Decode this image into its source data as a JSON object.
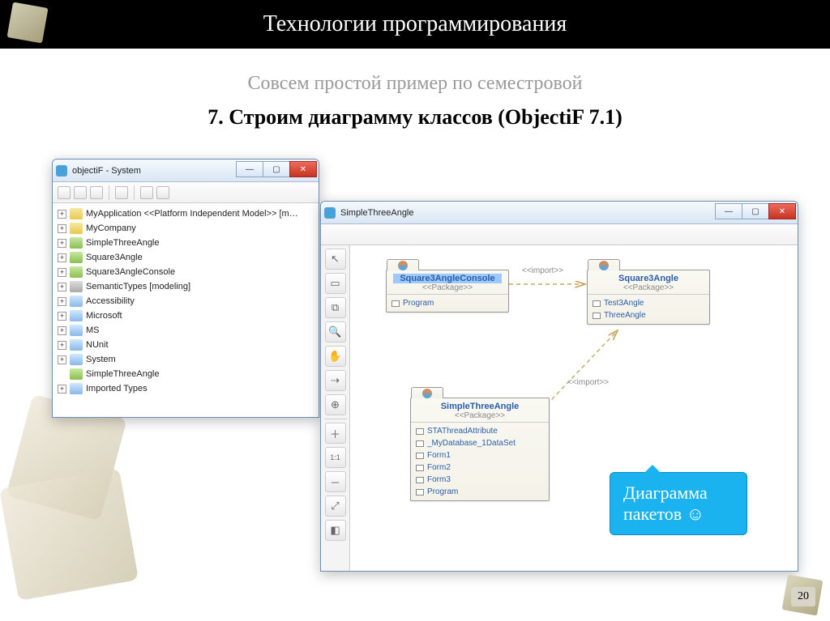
{
  "slide": {
    "header": "Технологии программирования",
    "subtitle_grey": "Совсем простой пример по семестровой",
    "subtitle_bold": "7. Строим диаграмму классов (ObjectiF 7.1)",
    "page_number": "20"
  },
  "tree_window": {
    "title": "objectiF - System",
    "items": [
      {
        "expand": "+",
        "icon": "folder",
        "label": "MyApplication <<Platform Independent Model>> [m…"
      },
      {
        "expand": "+",
        "icon": "folder",
        "label": "MyCompany"
      },
      {
        "expand": "+",
        "icon": "comp",
        "label": "SimpleThreeAngle"
      },
      {
        "expand": "+",
        "icon": "comp",
        "label": "Square3Angle"
      },
      {
        "expand": "+",
        "icon": "comp",
        "label": "Square3AngleConsole"
      },
      {
        "expand": "+",
        "icon": "sys",
        "label": "SemanticTypes [modeling]"
      },
      {
        "expand": "+",
        "icon": "pkg",
        "label": "Accessibility"
      },
      {
        "expand": "+",
        "icon": "pkg",
        "label": "Microsoft"
      },
      {
        "expand": "+",
        "icon": "pkg",
        "label": "MS"
      },
      {
        "expand": "+",
        "icon": "pkg",
        "label": "NUnit"
      },
      {
        "expand": "+",
        "icon": "pkg",
        "label": "System"
      },
      {
        "expand": "",
        "icon": "comp",
        "label": "SimpleThreeAngle"
      },
      {
        "expand": "+",
        "icon": "types",
        "label": "Imported Types"
      }
    ]
  },
  "diagram_window": {
    "title": "SimpleThreeAngle",
    "import_label1": "<<import>>",
    "import_label2": "<<import>>",
    "packages": {
      "console": {
        "name": "Square3AngleConsole",
        "stereo": "<<Package>>",
        "members": [
          "Program"
        ]
      },
      "angle": {
        "name": "Square3Angle",
        "stereo": "<<Package>>",
        "members": [
          "Test3Angle",
          "ThreeAngle"
        ]
      },
      "simple": {
        "name": "SimpleThreeAngle",
        "stereo": "<<Package>>",
        "members": [
          "STAThreadAttribute",
          "_MyDatabase_1DataSet",
          "Form1",
          "Form2",
          "Form3",
          "Program"
        ]
      }
    }
  },
  "callout": {
    "text": "Диаграмма пакетов ☺"
  }
}
